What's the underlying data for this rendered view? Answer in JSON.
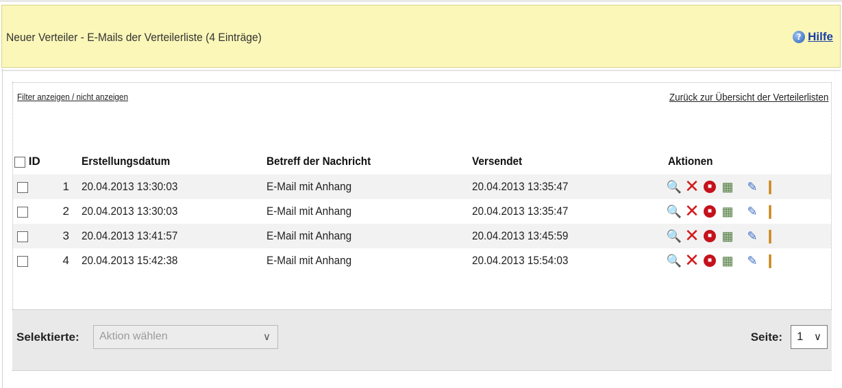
{
  "header": {
    "title": "Neuer Verteiler - E-Mails der Verteilerliste (4 Einträge)",
    "help_icon": "?",
    "help_label": "Hilfe"
  },
  "links": {
    "filter": "Filter anzeigen / nicht anzeigen",
    "back": "Zurück zur Übersicht der Verteilerlisten"
  },
  "table": {
    "columns": [
      "ID",
      "Erstellungsdatum",
      "Betreff der Nachricht",
      "Versendet",
      "Aktionen"
    ],
    "rows": [
      {
        "id": "1",
        "created": "20.04.2013 13:30:03",
        "subject": "E-Mail mit Anhang",
        "sent": "20.04.2013 13:35:47"
      },
      {
        "id": "2",
        "created": "20.04.2013 13:30:03",
        "subject": "E-Mail mit Anhang",
        "sent": "20.04.2013 13:35:47"
      },
      {
        "id": "3",
        "created": "20.04.2013 13:41:57",
        "subject": "E-Mail mit Anhang",
        "sent": "20.04.2013 13:45:59"
      },
      {
        "id": "4",
        "created": "20.04.2013 15:42:38",
        "subject": "E-Mail mit Anhang",
        "sent": "20.04.2013 15:54:03"
      }
    ],
    "action_icons": [
      "view-icon",
      "delete-icon",
      "stop-icon",
      "copy-icon",
      "edit-icon",
      "statistics-icon"
    ]
  },
  "footer": {
    "selected_label": "Selektierte:",
    "action_placeholder": "Aktion wählen",
    "page_label": "Seite:",
    "page_value": "1"
  }
}
